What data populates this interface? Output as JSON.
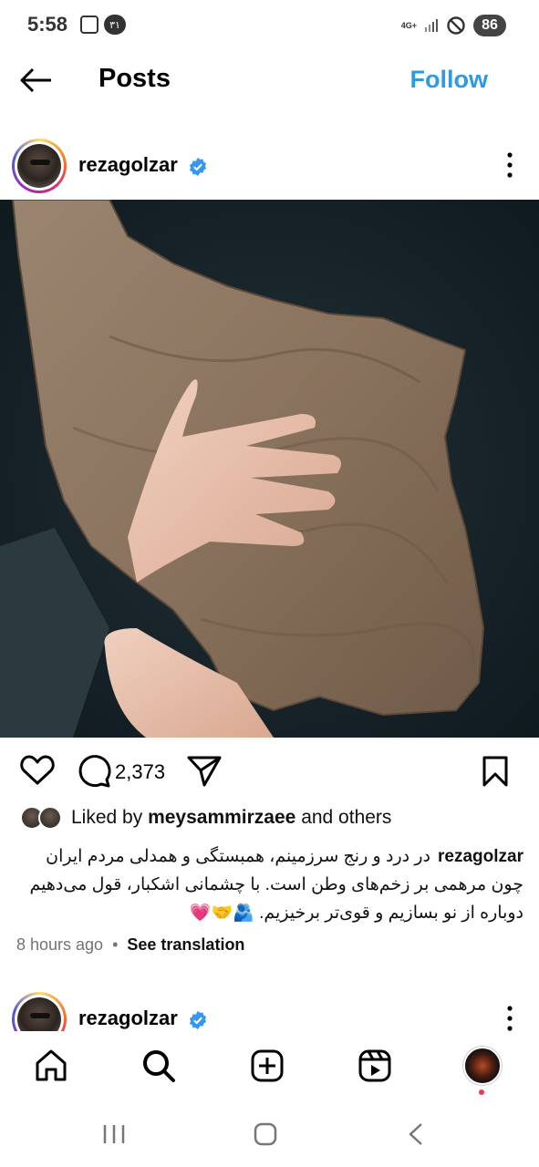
{
  "status_bar": {
    "time": "5:58",
    "pill": "٣١",
    "network": "4G+",
    "battery": "86"
  },
  "header": {
    "title": "Posts",
    "follow_label": "Follow"
  },
  "post": {
    "username": "rezagolzar",
    "comment_count": "2,373",
    "liked_by_prefix": "Liked by",
    "liked_by_user": "meysammirzaee",
    "liked_by_suffix": "and others",
    "caption_user": "rezagolzar",
    "caption": "در درد و رنج سرزمینم، همبستگی و همدلی مردم ایران چون مرهمی بر زخم‌های وطن است. با چشمانی اشکبار، قول می‌دهیم دوباره از نو بسازیم و قوی‌تر برخیزیم. 🫂🤝💗",
    "time_ago": "8 hours ago",
    "separator": "•",
    "see_translation": "See translation"
  },
  "next_post": {
    "username": "rezagolzar"
  },
  "colors": {
    "accent": "#2e9ae2",
    "verified": "#3897f0",
    "notification_dot": "#ff3040"
  }
}
